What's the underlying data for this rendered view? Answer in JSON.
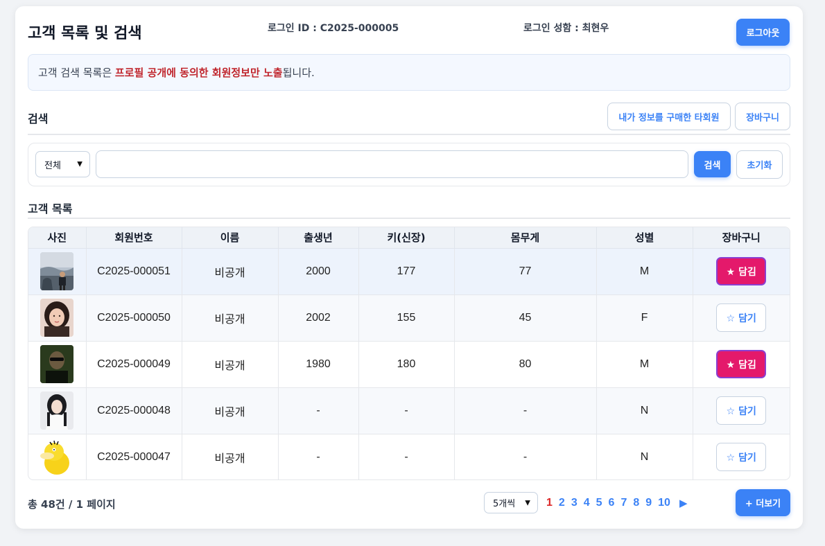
{
  "header": {
    "title": "고객 목록 및 검색",
    "login_id": "로그인 ID : C2025-000005",
    "login_name": "로그인 성함 : 최현우",
    "logout_label": "로그아웃"
  },
  "notice": {
    "prefix": "고객 검색 목록은 ",
    "highlight": "프로필 공개에 동의한 회원정보만 노출",
    "suffix": "됩니다."
  },
  "search": {
    "section_title": "검색",
    "purchased_button": "내가 정보를 구매한 타회원",
    "cart_button": "장바구니",
    "filter_selected": "전체",
    "query_value": "",
    "search_button": "검색",
    "reset_button": "초기화"
  },
  "list": {
    "section_title": "고객 목록",
    "columns": [
      "사진",
      "회원번호",
      "이름",
      "출생년",
      "키(신장)",
      "몸무게",
      "성별",
      "장바구니"
    ],
    "rows": [
      {
        "member_no": "C2025-000051",
        "name": "비공개",
        "birth_year": "2000",
        "height": "177",
        "weight": "77",
        "gender": "M",
        "cart_label": "★ 담김",
        "in_cart": true,
        "photo_icon": "person-outdoor-photo"
      },
      {
        "member_no": "C2025-000050",
        "name": "비공개",
        "birth_year": "2002",
        "height": "155",
        "weight": "45",
        "gender": "F",
        "cart_label": "☆ 담기",
        "in_cart": false,
        "photo_icon": "woman-portrait-photo"
      },
      {
        "member_no": "C2025-000049",
        "name": "비공개",
        "birth_year": "1980",
        "height": "180",
        "weight": "80",
        "gender": "M",
        "cart_label": "★ 담김",
        "in_cart": true,
        "photo_icon": "man-sunglasses-photo"
      },
      {
        "member_no": "C2025-000048",
        "name": "비공개",
        "birth_year": "-",
        "height": "-",
        "weight": "-",
        "gender": "N",
        "cart_label": "☆ 담기",
        "in_cart": false,
        "photo_icon": "woman-white-shirt-photo"
      },
      {
        "member_no": "C2025-000047",
        "name": "비공개",
        "birth_year": "-",
        "height": "-",
        "weight": "-",
        "gender": "N",
        "cart_label": "☆ 담기",
        "in_cart": false,
        "photo_icon": "yellow-duck-cartoon"
      }
    ]
  },
  "footer": {
    "total": "총 48건 / 1 페이지",
    "page_size": "5개씩",
    "pages": [
      "1",
      "2",
      "3",
      "4",
      "5",
      "6",
      "7",
      "8",
      "9",
      "10"
    ],
    "current_page": "1",
    "more_button": "+ 더보기"
  },
  "colors": {
    "primary": "#3b82f6",
    "cart_active": "#e4196b",
    "highlight": "#c0262d"
  }
}
